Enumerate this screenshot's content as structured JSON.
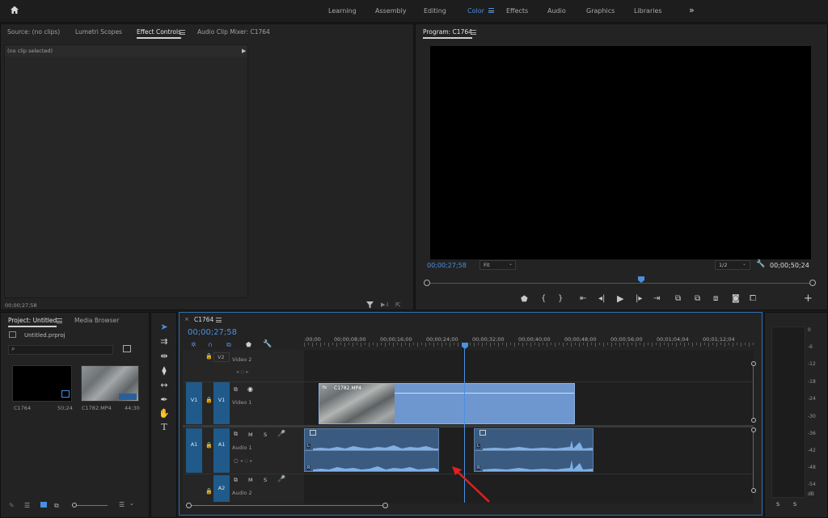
{
  "topbar": {
    "workspaces": [
      "Learning",
      "Assembly",
      "Editing",
      "Color",
      "Effects",
      "Audio",
      "Graphics",
      "Libraries"
    ],
    "active_workspace": "Color",
    "more": "»"
  },
  "source_panel": {
    "tabs": [
      "Source: (no clips)",
      "Lumetri Scopes",
      "Effect Controls",
      "Audio Clip Mixer: C1764"
    ],
    "active_tab": "Effect Controls",
    "clip_status": "(no clip selected)",
    "timecode": "00;00;27;58"
  },
  "program_panel": {
    "title": "Program: C1764",
    "timecode": "00;00;27;58",
    "fit": "Fit",
    "resolution": "1/2",
    "duration": "00;00;50;24"
  },
  "project_panel": {
    "tabs": [
      "Project: Untitled",
      "Media Browser"
    ],
    "project_file": "Untitled.prproj",
    "items": [
      {
        "name": "C1764",
        "duration": "50;24"
      },
      {
        "name": "C1782.MP4",
        "duration": "44;30"
      }
    ]
  },
  "timeline": {
    "sequence_name": "C1764",
    "timecode": "00;00;27;58",
    "ruler": [
      ":00;00",
      "00;00;08;00",
      "00;00;16;00",
      "00;00;24;00",
      "00;00;32;00",
      "00;00;40;00",
      "00;00;48;00",
      "00;00;56;00",
      "00;01;04;04",
      "00;01;12;04"
    ],
    "tracks": {
      "v2": {
        "target": "V2",
        "name": "Video 2"
      },
      "v1": {
        "source": "V1",
        "target": "V1",
        "name": "Video 1"
      },
      "a1": {
        "source": "A1",
        "target": "A1",
        "name": "Audio 1",
        "mute": "M",
        "solo": "S"
      },
      "a2": {
        "target": "A2",
        "name": "Audio 2",
        "mute": "M",
        "solo": "S"
      }
    },
    "video_clip": {
      "fx": "fx",
      "name": "C1782.MP4"
    },
    "audio_channel_labels": [
      "L",
      "R"
    ]
  },
  "meters": {
    "scale": [
      "0",
      "-6",
      "-12",
      "-18",
      "-24",
      "-30",
      "-36",
      "-42",
      "-48",
      "-54",
      "dB"
    ],
    "solo_labels": [
      "S",
      "S"
    ]
  },
  "colors": {
    "accent": "#4a90e2",
    "clip_video": "#6f97cf",
    "clip_audio": "#3a5a80",
    "track_target": "#1f5a8a",
    "annotation": "#e02020"
  }
}
